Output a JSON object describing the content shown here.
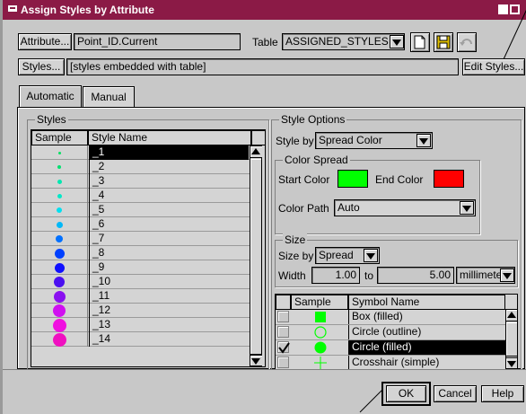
{
  "window": {
    "title": "Assign Styles by Attribute"
  },
  "top": {
    "attribute_button": "Attribute...",
    "attribute_value": "Point_ID.Current",
    "table_label": "Table",
    "table_value": "ASSIGNED_STYLES",
    "styles_button": "Styles...",
    "styles_value": "[styles embedded with table]",
    "edit_styles_button": "Edit Styles..."
  },
  "tabs": [
    {
      "label": "Automatic"
    },
    {
      "label": "Manual"
    }
  ],
  "styles_panel": {
    "title": "Styles",
    "col_sample": "Sample",
    "col_name": "Style Name",
    "rows": [
      {
        "name": "_1",
        "color": "#00e060",
        "dot": 3,
        "selected": true
      },
      {
        "name": "_2",
        "color": "#00e070",
        "dot": 4,
        "selected": false
      },
      {
        "name": "_3",
        "color": "#00e8b0",
        "dot": 5,
        "selected": false
      },
      {
        "name": "_4",
        "color": "#00e8c8",
        "dot": 5,
        "selected": false
      },
      {
        "name": "_5",
        "color": "#00e0f0",
        "dot": 6,
        "selected": false
      },
      {
        "name": "_6",
        "color": "#00b8f8",
        "dot": 7,
        "selected": false
      },
      {
        "name": "_7",
        "color": "#0070ff",
        "dot": 8,
        "selected": false
      },
      {
        "name": "_8",
        "color": "#0040ff",
        "dot": 11,
        "selected": false
      },
      {
        "name": "_9",
        "color": "#1010ff",
        "dot": 11,
        "selected": false
      },
      {
        "name": "_10",
        "color": "#4a10f0",
        "dot": 12,
        "selected": false
      },
      {
        "name": "_11",
        "color": "#8a10f0",
        "dot": 13,
        "selected": false
      },
      {
        "name": "_12",
        "color": "#d010f0",
        "dot": 14,
        "selected": false
      },
      {
        "name": "_13",
        "color": "#f010e0",
        "dot": 15,
        "selected": false
      },
      {
        "name": "_14",
        "color": "#f010c0",
        "dot": 15,
        "selected": false
      }
    ]
  },
  "style_options": {
    "title": "Style Options",
    "style_by_label": "Style by",
    "style_by_value": "Spread Color",
    "color_spread": {
      "title": "Color Spread",
      "start_label": "Start Color",
      "start_color": "#00ff00",
      "end_label": "End Color",
      "end_color": "#ff0000",
      "path_label": "Color Path",
      "path_value": "Auto"
    },
    "size": {
      "title": "Size",
      "size_by_label": "Size by",
      "size_by_value": "Spread",
      "width_label": "Width",
      "width_from": "1.00",
      "to_label": "to",
      "width_to": "5.00",
      "unit": "millimeters"
    },
    "symbols": {
      "col_sample": "Sample",
      "col_name": "Symbol Name",
      "rows": [
        {
          "name": "Box (filled)",
          "icon": "box-filled",
          "checked": false,
          "selected": false
        },
        {
          "name": "Circle (outline)",
          "icon": "circle-outline",
          "checked": false,
          "selected": false
        },
        {
          "name": "Circle (filled)",
          "icon": "circle-filled",
          "checked": true,
          "selected": true
        },
        {
          "name": "Crosshair (simple)",
          "icon": "crosshair",
          "checked": false,
          "selected": false
        }
      ]
    }
  },
  "footer": {
    "ok": "OK",
    "cancel": "Cancel",
    "help": "Help"
  }
}
